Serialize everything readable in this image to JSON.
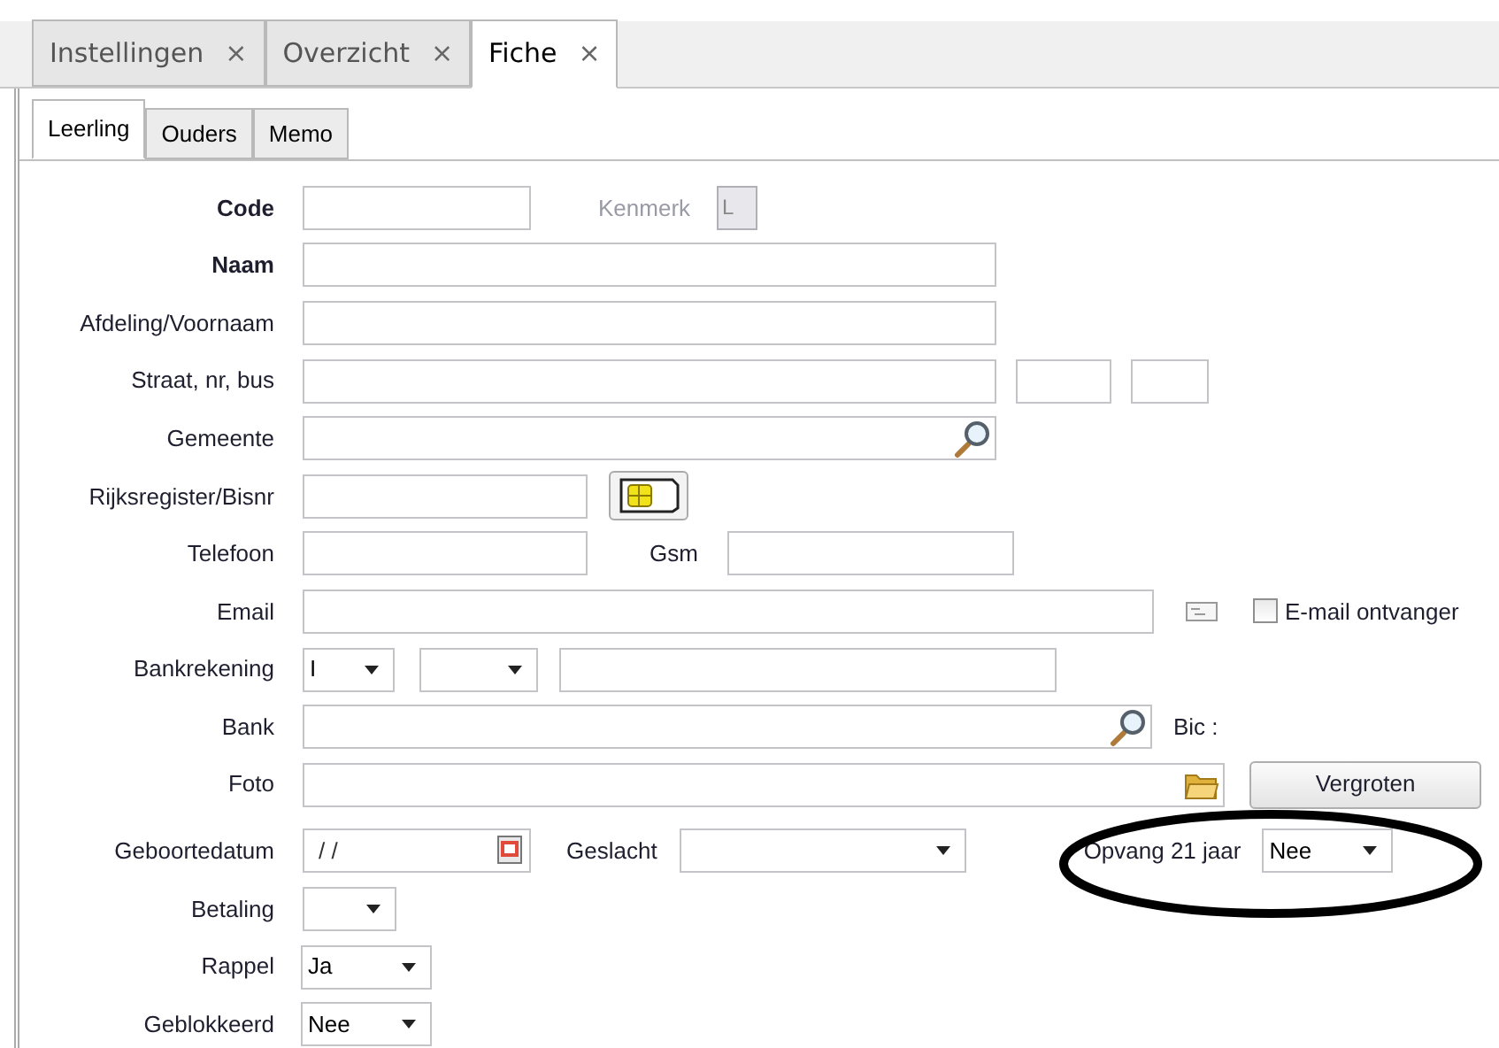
{
  "tabs": [
    {
      "label": "Instellingen",
      "close": "×",
      "selected": false
    },
    {
      "label": "Overzicht",
      "close": "×",
      "selected": false
    },
    {
      "label": "Fiche",
      "close": "×",
      "selected": true
    }
  ],
  "subtabs": [
    {
      "label": "Leerling",
      "selected": true
    },
    {
      "label": "Ouders",
      "selected": false
    },
    {
      "label": "Memo",
      "selected": false
    }
  ],
  "form": {
    "code": {
      "label": "Code",
      "bold": true
    },
    "kenmerk": {
      "label": "Kenmerk",
      "value": "L",
      "disabled": true
    },
    "naam": {
      "label": "Naam",
      "bold": true
    },
    "afdeling": {
      "label": "Afdeling/Voornaam",
      "bold": false
    },
    "straat": {
      "label": "Straat, nr, bus",
      "bold": false
    },
    "gemeente": {
      "label": "Gemeente",
      "bold": false
    },
    "rijksregister": {
      "label": "Rijksregister/Bisnr",
      "bold": false
    },
    "telefoon": {
      "label": "Telefoon",
      "bold": false
    },
    "gsm": {
      "label": "Gsm"
    },
    "email": {
      "label": "Email",
      "bold": false
    },
    "email_ontvanger": {
      "label": "E-mail ontvanger",
      "checked": false
    },
    "bankrekening": {
      "label": "Bankrekening",
      "bold": false,
      "value": "I"
    },
    "bank": {
      "label": "Bank",
      "bold": false
    },
    "bic": {
      "label": "Bic :"
    },
    "foto": {
      "label": "Foto",
      "bold": false
    },
    "vergroten_button": "Vergroten",
    "geboortedatum": {
      "label": "Geboortedatum",
      "bold": false,
      "value": "/ /"
    },
    "geslacht": {
      "label": "Geslacht"
    },
    "opvang": {
      "label": "Opvang 21 jaar",
      "value": "Nee"
    },
    "betaling": {
      "label": "Betaling",
      "bold": false
    },
    "rappel": {
      "label": "Rappel",
      "bold": false,
      "value": "Ja"
    },
    "geblokkeerd": {
      "label": "Geblokkeerd",
      "bold": false,
      "value": "Nee"
    }
  }
}
